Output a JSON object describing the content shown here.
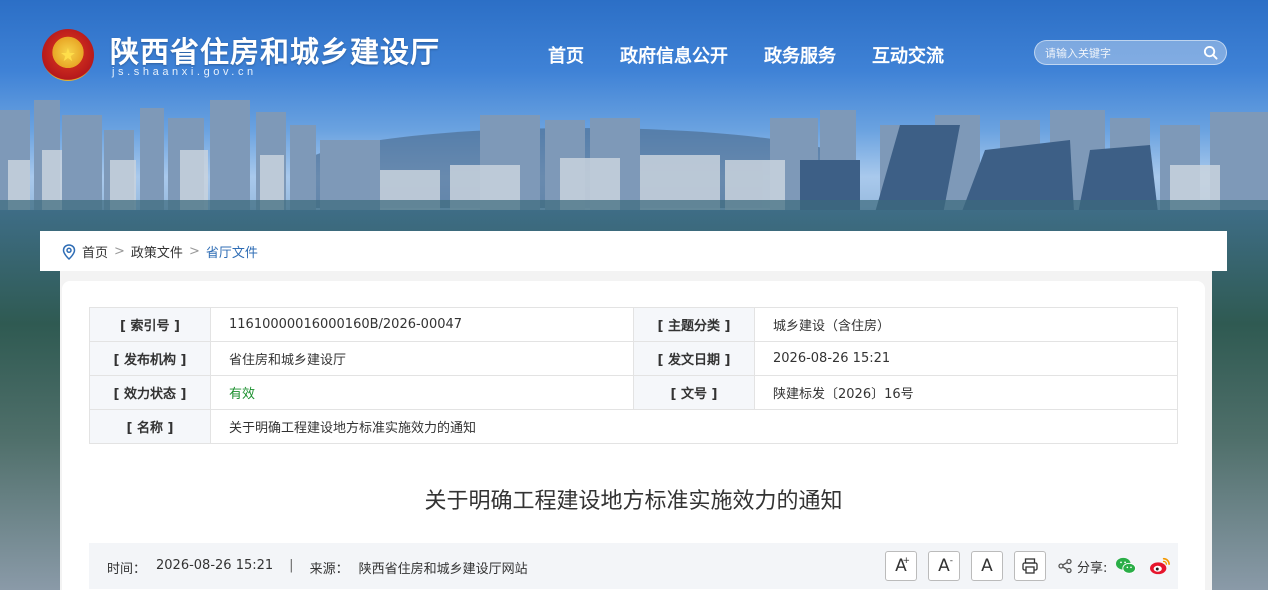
{
  "header": {
    "site_title": "陕西省住房和城乡建设厅",
    "site_url": "js.shaanxi.gov.cn",
    "nav": [
      "首页",
      "政府信息公开",
      "政务服务",
      "互动交流"
    ],
    "search_placeholder": "请输入关键字"
  },
  "breadcrumb": {
    "items": [
      "首页",
      "政策文件",
      "省厅文件"
    ],
    "separator": ">"
  },
  "meta": {
    "index_label": "[ 索引号 ]",
    "index_value": "11610000016000160B/2026-00047",
    "topic_label": "[ 主题分类 ]",
    "topic_value": "城乡建设（含住房）",
    "org_label": "[ 发布机构 ]",
    "org_value": "省住房和城乡建设厅",
    "date_label": "[ 发文日期 ]",
    "date_value": "2026-08-26 15:21",
    "status_label": "[ 效力状态 ]",
    "status_value": "有效",
    "docno_label": "[ 文号 ]",
    "docno_value": "陕建标发〔2026〕16号",
    "name_label": "[ 名称 ]",
    "name_value": "关于明确工程建设地方标准实施效力的通知"
  },
  "article": {
    "title": "关于明确工程建设地方标准实施效力的通知",
    "time_label": "时间：",
    "time_value": "2026-08-26 15:21",
    "divider": "|",
    "source_label": "来源：",
    "source_value": "陕西省住房和城乡建设厅网站"
  },
  "tools": {
    "font_large": "A",
    "font_large_sup": "+",
    "font_small": "A",
    "font_small_sup": "-",
    "font_reset": "A",
    "share_label": "分享:"
  },
  "colors": {
    "nav_text": "#ffffff",
    "link_blue": "#2f6db5",
    "status_green": "#1b8f2e"
  }
}
